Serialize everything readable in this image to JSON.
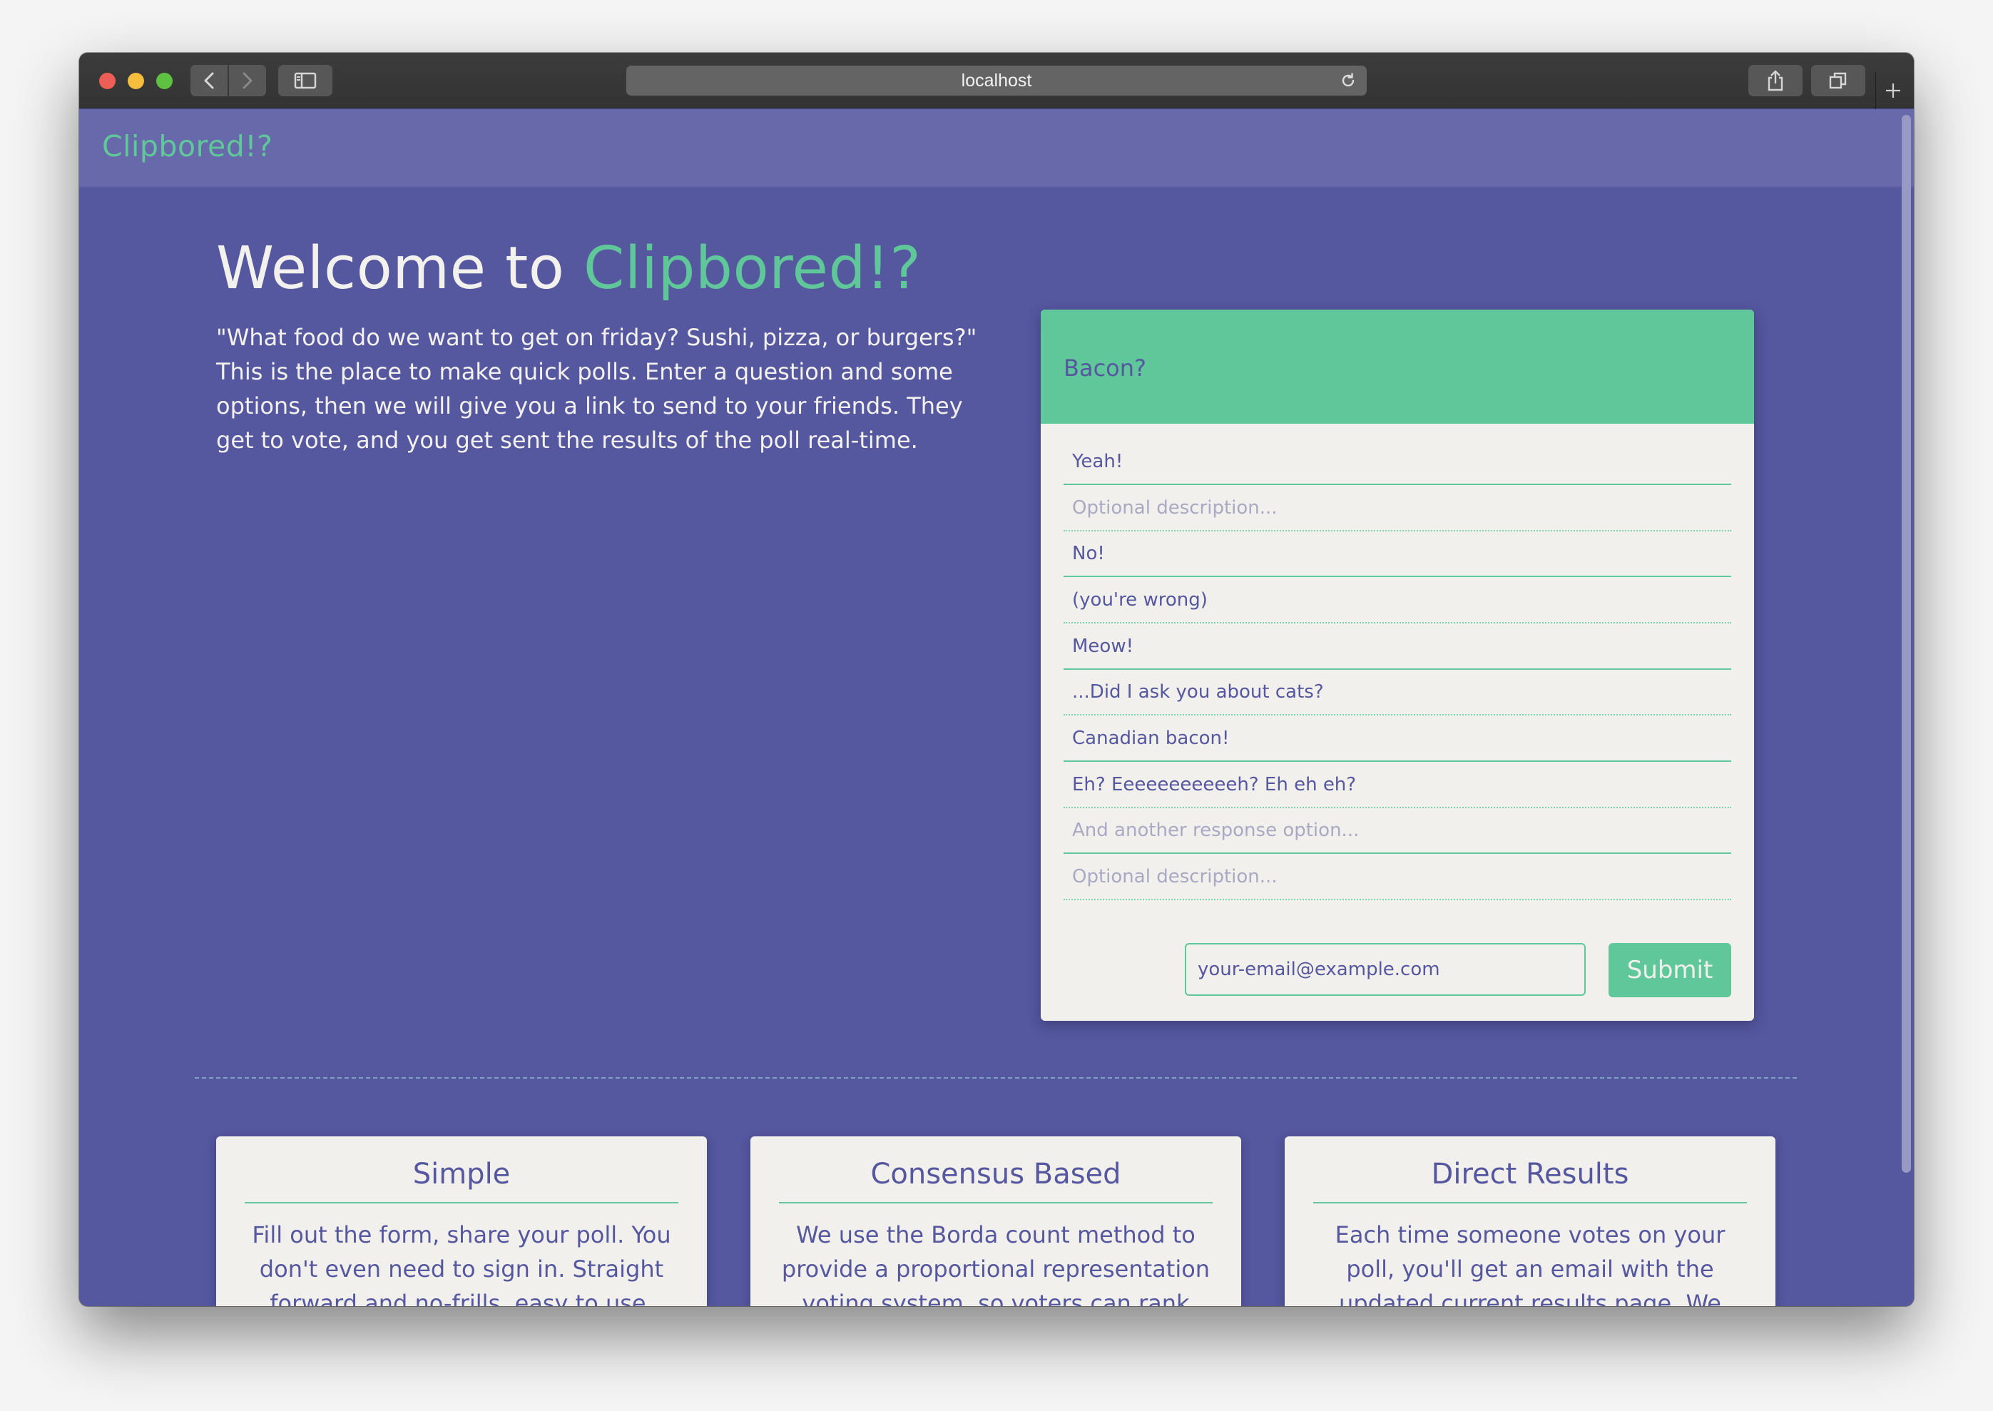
{
  "browser": {
    "url": "localhost"
  },
  "header": {
    "brand": "Clipbored!?"
  },
  "hero": {
    "title_prefix": "Welcome to ",
    "title_accent": "Clipbored!?",
    "description": "\"What food do we want to get on friday? Sushi, pizza, or burgers?\" This is the place to make quick polls. Enter a question and some options, then we will give you a link to send to your friends. They get to vote, and you get sent the results of the poll real-time."
  },
  "poll": {
    "question": "Bacon?",
    "fields": [
      {
        "kind": "option",
        "value": "Yeah!",
        "placeholder": ""
      },
      {
        "kind": "desc",
        "value": "",
        "placeholder": "Optional description..."
      },
      {
        "kind": "option",
        "value": "No!",
        "placeholder": ""
      },
      {
        "kind": "desc",
        "value": "(you're wrong)",
        "placeholder": ""
      },
      {
        "kind": "option",
        "value": "Meow!",
        "placeholder": ""
      },
      {
        "kind": "desc",
        "value": "...Did I ask you about cats?",
        "placeholder": ""
      },
      {
        "kind": "option",
        "value": "Canadian bacon!",
        "placeholder": ""
      },
      {
        "kind": "desc",
        "value": "Eh? Eeeeeeeeeeeh? Eh eh eh?",
        "placeholder": ""
      },
      {
        "kind": "option",
        "value": "",
        "placeholder": "And another response option..."
      },
      {
        "kind": "desc",
        "value": "",
        "placeholder": "Optional description..."
      }
    ],
    "email_value": "your-email@example.com",
    "submit_label": "Submit"
  },
  "features": [
    {
      "title": "Simple",
      "text": "Fill out the form, share your poll. You don't even need to sign in. Straight forward and no-frills, easy to use, always free."
    },
    {
      "title": "Consensus Based",
      "text": "We use the Borda count method to provide a proportional representation voting system, so voters can rank their choices instead of only choosing one."
    },
    {
      "title": "Direct Results",
      "text": "Each time someone votes on your poll, you'll get an email with the updated current results page. We promise we will never spam you!"
    }
  ],
  "colors": {
    "page_bg": "#55579f",
    "header_bg": "#6769ab",
    "accent": "#60c79a",
    "card_bg": "#f2f0ec"
  }
}
